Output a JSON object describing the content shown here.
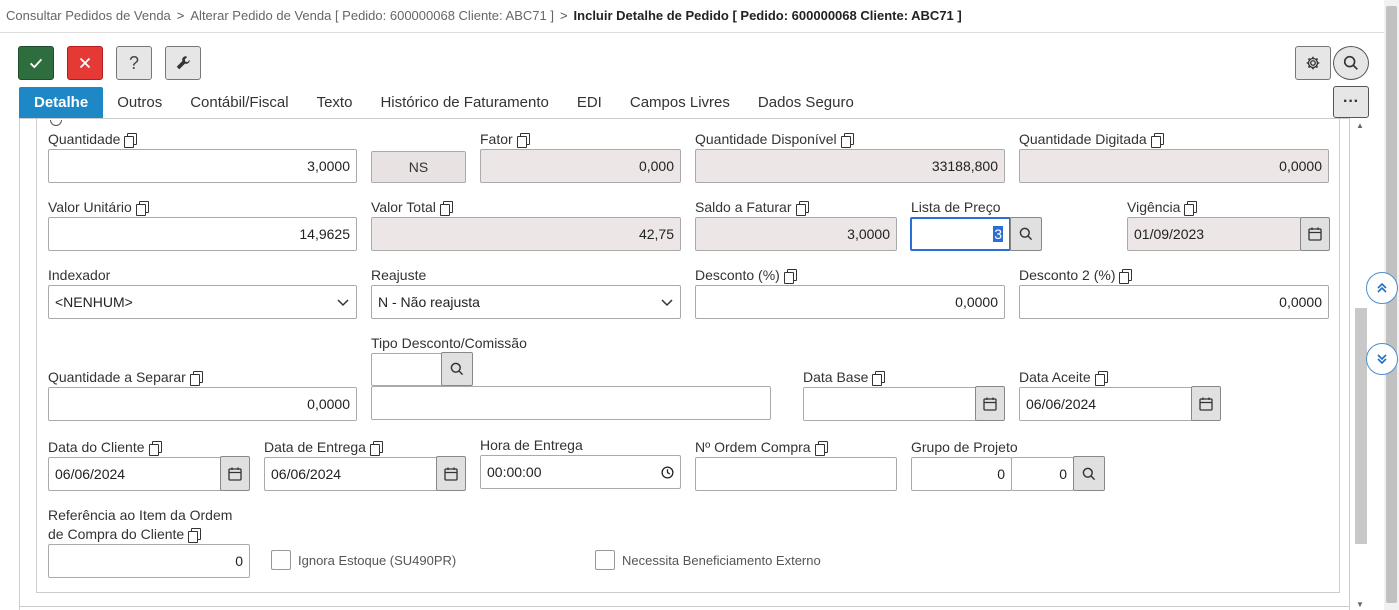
{
  "breadcrumb": {
    "items": [
      "Consultar Pedidos de Venda",
      "Alterar Pedido de Venda [ Pedido: 600000068 Cliente: ABC71 ]"
    ],
    "current": "Incluir Detalhe de Pedido [ Pedido: 600000068 Cliente: ABC71 ]",
    "separator": ">"
  },
  "toolbar": {
    "confirm_icon": "check-icon",
    "cancel_icon": "close-icon",
    "help_label": "?",
    "tools_icon": "wrench-icon",
    "settings_icon": "gear-icon",
    "search_icon": "search-icon"
  },
  "tabs": [
    {
      "label": "Detalhe",
      "active": true
    },
    {
      "label": "Outros"
    },
    {
      "label": "Contábil/Fiscal"
    },
    {
      "label": "Texto"
    },
    {
      "label": "Histórico de Faturamento"
    },
    {
      "label": "EDI"
    },
    {
      "label": "Campos Livres"
    },
    {
      "label": "Dados Seguro"
    }
  ],
  "tabs_more": "···",
  "form": {
    "quantidade": {
      "label": "Quantidade",
      "value": "3,0000",
      "unit": "NS"
    },
    "fator": {
      "label": "Fator",
      "value": "0,000"
    },
    "qtd_disponivel": {
      "label": "Quantidade Disponível",
      "value": "33188,800"
    },
    "qtd_digitada": {
      "label": "Quantidade Digitada",
      "value": "0,0000"
    },
    "valor_unitario": {
      "label": "Valor Unitário",
      "value": "14,9625"
    },
    "valor_total": {
      "label": "Valor Total",
      "value": "42,75"
    },
    "saldo_faturar": {
      "label": "Saldo a Faturar",
      "value": "3,0000"
    },
    "lista_preco": {
      "label": "Lista de Preço",
      "value": "3"
    },
    "vigencia": {
      "label": "Vigência",
      "value": "01/09/2023"
    },
    "indexador": {
      "label": "Indexador",
      "value": "<NENHUM>"
    },
    "reajuste": {
      "label": "Reajuste",
      "value": "N - Não reajusta"
    },
    "desconto": {
      "label": "Desconto (%)",
      "value": "0,0000"
    },
    "desconto2": {
      "label": "Desconto 2 (%)",
      "value": "0,0000"
    },
    "qtd_separar": {
      "label": "Quantidade a Separar",
      "value": "0,0000"
    },
    "tipo_desconto": {
      "label": "Tipo Desconto/Comissão",
      "code": "",
      "description": ""
    },
    "data_base": {
      "label": "Data Base",
      "value": ""
    },
    "data_aceite": {
      "label": "Data Aceite",
      "value": "06/06/2024"
    },
    "data_cliente": {
      "label": "Data do Cliente",
      "value": "06/06/2024"
    },
    "data_entrega": {
      "label": "Data de Entrega",
      "value": "06/06/2024"
    },
    "hora_entrega": {
      "label": "Hora de Entrega",
      "value": "00:00:00"
    },
    "ordem_compra": {
      "label": "Nº Ordem Compra",
      "value": ""
    },
    "grupo_projeto": {
      "label": "Grupo de Projeto",
      "value1": "0",
      "value2": "0"
    },
    "ref_item": {
      "label_line1": "Referência ao Item da Ordem",
      "label_line2": "de Compra do Cliente",
      "value": "0"
    },
    "ignora_estoque": {
      "label": "Ignora Estoque (SU490PR)",
      "checked": false
    },
    "beneficiamento": {
      "label": "Necessita Beneficiamento Externo",
      "checked": false
    }
  }
}
